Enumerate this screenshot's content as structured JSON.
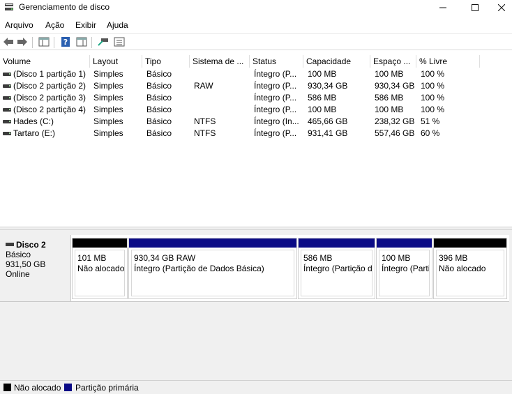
{
  "window": {
    "title": "Gerenciamento de disco",
    "icon": "disk-management-icon",
    "controls": [
      "minimize-icon",
      "maximize-icon",
      "close-icon"
    ]
  },
  "menu": [
    "Arquivo",
    "Ação",
    "Exibir",
    "Ajuda"
  ],
  "toolbar": [
    "back-arrow-icon",
    "forward-arrow-icon",
    "console-tree-icon",
    "help-icon",
    "properties-icon",
    "connect-icon",
    "list-view-icon"
  ],
  "columns": [
    "Volume",
    "Layout",
    "Tipo",
    "Sistema de ...",
    "Status",
    "Capacidade",
    "Espaço ...",
    "% Livre"
  ],
  "volumes": [
    [
      "(Disco 1 partição 1)",
      "Simples",
      "Básico",
      "",
      "Íntegro (P...",
      "100 MB",
      "100 MB",
      "100 %"
    ],
    [
      "(Disco 2 partição 2)",
      "Simples",
      "Básico",
      "RAW",
      "Íntegro (P...",
      "930,34 GB",
      "930,34 GB",
      "100 %"
    ],
    [
      "(Disco 2 partição 3)",
      "Simples",
      "Básico",
      "",
      "Íntegro (P...",
      "586 MB",
      "586 MB",
      "100 %"
    ],
    [
      "(Disco 2 partição 4)",
      "Simples",
      "Básico",
      "",
      "Íntegro (P...",
      "100 MB",
      "100 MB",
      "100 %"
    ],
    [
      "Hades (C:)",
      "Simples",
      "Básico",
      "NTFS",
      "Íntegro (In...",
      "465,66 GB",
      "238,32 GB",
      "51 %"
    ],
    [
      "Tartaro (E:)",
      "Simples",
      "Básico",
      "NTFS",
      "Íntegro (P...",
      "931,41 GB",
      "557,46 GB",
      "60 %"
    ]
  ],
  "disk": {
    "name": "Disco 2",
    "type": "Básico",
    "size": "931,50 GB",
    "status": "Online"
  },
  "partitions": [
    {
      "kind": "unalloc",
      "line1": "101 MB",
      "line2": "Não alocado"
    },
    {
      "kind": "primary",
      "line1": "930,34 GB RAW",
      "line2": "Íntegro (Partição de Dados Básica)"
    },
    {
      "kind": "primary",
      "line1": "586 MB",
      "line2": "Íntegro (Partição de"
    },
    {
      "kind": "primary",
      "line1": "100 MB",
      "line2": "Íntegro (Partição"
    },
    {
      "kind": "unalloc",
      "line1": "396 MB",
      "line2": "Não alocado"
    }
  ],
  "legend": [
    {
      "label": "Não alocado",
      "color": "#000000"
    },
    {
      "label": "Partição primária",
      "color": "#0b0b86"
    }
  ]
}
